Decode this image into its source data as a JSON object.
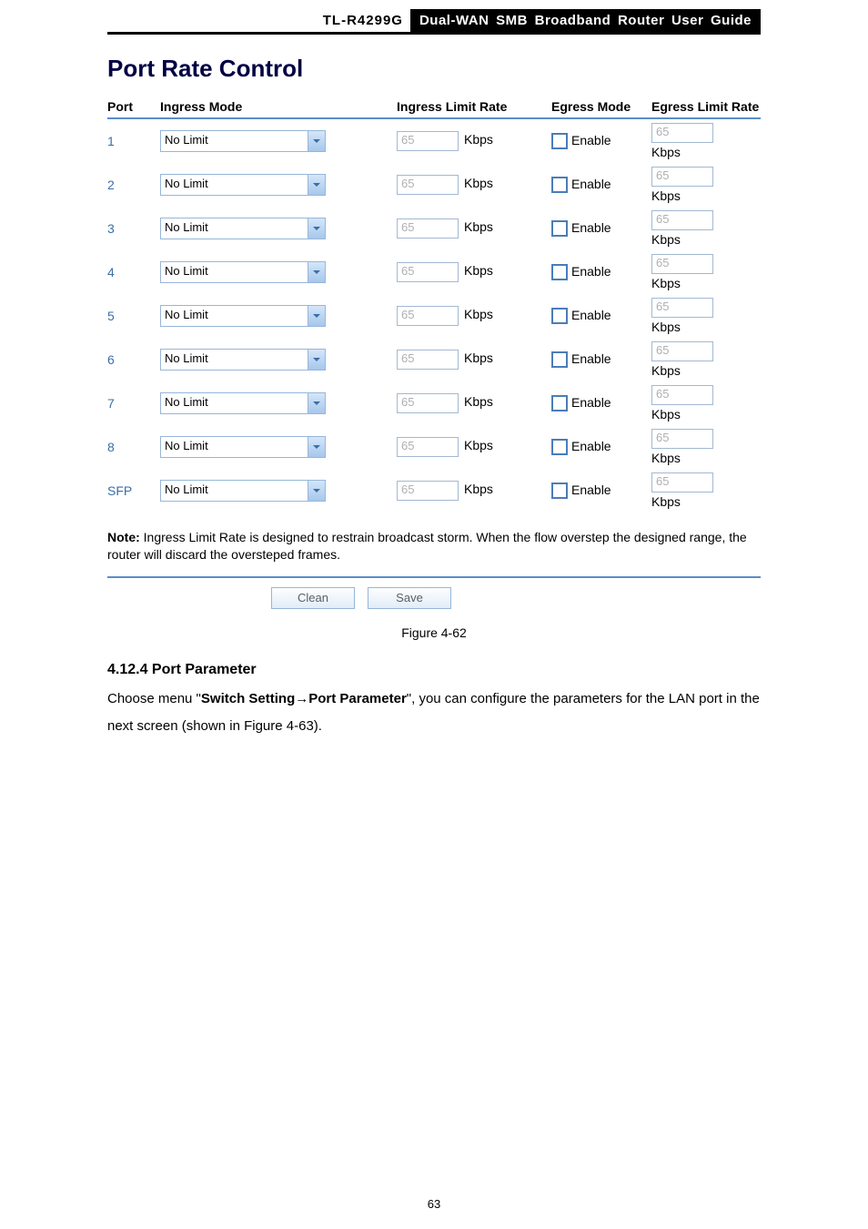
{
  "header": {
    "model": "TL-R4299G",
    "guide_title": "Dual-WAN SMB Broadband Router User Guide"
  },
  "section_title": "Port Rate Control",
  "table": {
    "columns": {
      "port": "Port",
      "ingress_mode": "Ingress Mode",
      "ingress_rate": "Ingress Limit Rate",
      "egress_mode": "Egress Mode",
      "egress_rate": "Egress Limit Rate"
    },
    "rows": [
      {
        "port": "1",
        "ingress_mode": "No Limit",
        "ingress_rate": "65",
        "ingress_unit": "Kbps",
        "egress_checked": false,
        "egress_label": "Enable",
        "egress_rate": "65",
        "egress_unit": "Kbps"
      },
      {
        "port": "2",
        "ingress_mode": "No Limit",
        "ingress_rate": "65",
        "ingress_unit": "Kbps",
        "egress_checked": false,
        "egress_label": "Enable",
        "egress_rate": "65",
        "egress_unit": "Kbps"
      },
      {
        "port": "3",
        "ingress_mode": "No Limit",
        "ingress_rate": "65",
        "ingress_unit": "Kbps",
        "egress_checked": false,
        "egress_label": "Enable",
        "egress_rate": "65",
        "egress_unit": "Kbps"
      },
      {
        "port": "4",
        "ingress_mode": "No Limit",
        "ingress_rate": "65",
        "ingress_unit": "Kbps",
        "egress_checked": false,
        "egress_label": "Enable",
        "egress_rate": "65",
        "egress_unit": "Kbps"
      },
      {
        "port": "5",
        "ingress_mode": "No Limit",
        "ingress_rate": "65",
        "ingress_unit": "Kbps",
        "egress_checked": false,
        "egress_label": "Enable",
        "egress_rate": "65",
        "egress_unit": "Kbps"
      },
      {
        "port": "6",
        "ingress_mode": "No Limit",
        "ingress_rate": "65",
        "ingress_unit": "Kbps",
        "egress_checked": false,
        "egress_label": "Enable",
        "egress_rate": "65",
        "egress_unit": "Kbps"
      },
      {
        "port": "7",
        "ingress_mode": "No Limit",
        "ingress_rate": "65",
        "ingress_unit": "Kbps",
        "egress_checked": false,
        "egress_label": "Enable",
        "egress_rate": "65",
        "egress_unit": "Kbps"
      },
      {
        "port": "8",
        "ingress_mode": "No Limit",
        "ingress_rate": "65",
        "ingress_unit": "Kbps",
        "egress_checked": false,
        "egress_label": "Enable",
        "egress_rate": "65",
        "egress_unit": "Kbps"
      },
      {
        "port": "SFP",
        "ingress_mode": "No Limit",
        "ingress_rate": "65",
        "ingress_unit": "Kbps",
        "egress_checked": false,
        "egress_label": "Enable",
        "egress_rate": "65",
        "egress_unit": "Kbps"
      }
    ]
  },
  "note": {
    "label": "Note:",
    "text": " Ingress Limit Rate is designed to restrain broadcast storm. When the flow overstep the designed range, the router will discard the oversteped frames."
  },
  "buttons": {
    "clean": "Clean",
    "save": "Save"
  },
  "figure_caption": "Figure 4-62",
  "subsection": {
    "number_title": "4.12.4  Port Parameter",
    "body_pre": "Choose menu \"",
    "body_bold1": "Switch Setting",
    "body_arrow": "→",
    "body_bold2": "Port Parameter",
    "body_post": "\", you can configure the parameters for the LAN port in the next screen (shown in Figure 4-63)."
  },
  "page_number": "63"
}
